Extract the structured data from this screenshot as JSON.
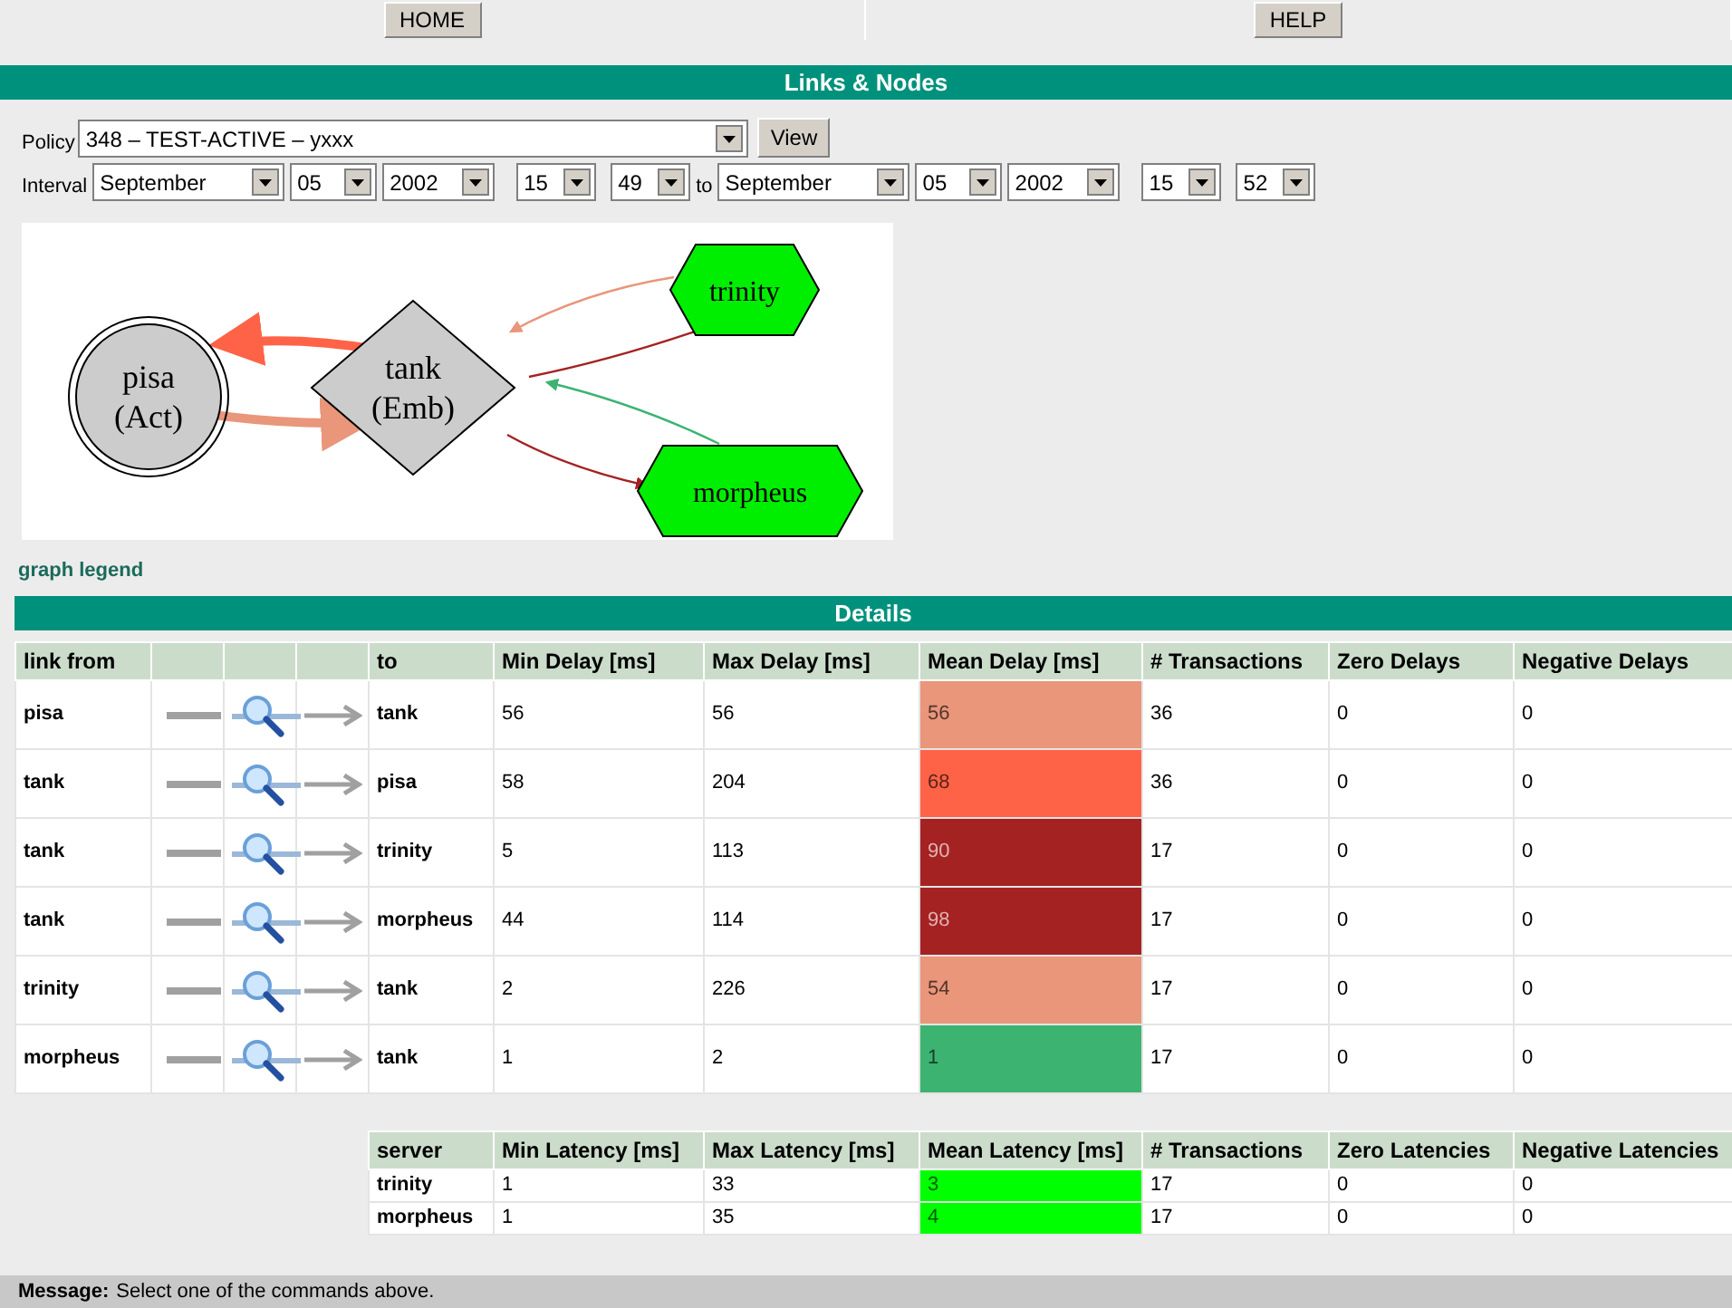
{
  "nav": [
    {
      "label": "HOME"
    },
    {
      "label": "HELP"
    }
  ],
  "links_header": "Links & Nodes",
  "policy": {
    "label": "Policy",
    "value": "348 – TEST-ACTIVE – yxxx",
    "button": "View"
  },
  "interval": {
    "label": "Interval",
    "from": [
      "September",
      "05",
      "2002",
      "15",
      "49"
    ],
    "to_label": "to",
    "to": [
      "September",
      "05",
      "2002",
      "15",
      "52"
    ]
  },
  "graph": {
    "nodes": [
      {
        "kind": "circle",
        "lines": [
          "pisa",
          "(Act)"
        ]
      },
      {
        "kind": "diamond",
        "lines": [
          "tank",
          "(Emb)"
        ]
      },
      {
        "kind": "hexagon",
        "lines": [
          "trinity"
        ]
      },
      {
        "kind": "hexagon",
        "lines": [
          "morpheus"
        ]
      }
    ]
  },
  "graph_legend": "graph legend",
  "details_header": "Details",
  "links_table": {
    "columns": [
      "link from",
      "to",
      "Min Delay [ms]",
      "Max Delay [ms]",
      "Mean Delay [ms]",
      "# Transactions",
      "Zero Delays",
      "Negative Delays"
    ],
    "rows": [
      {
        "from": "pisa",
        "to": "tank",
        "min": "56",
        "max": "56",
        "mean": "56",
        "color": "#e9967a",
        "transactions": "36",
        "zero": "0",
        "negative": "0"
      },
      {
        "from": "tank",
        "to": "pisa",
        "min": "58",
        "max": "204",
        "mean": "68",
        "color": "#ff6347",
        "transactions": "36",
        "zero": "0",
        "negative": "0"
      },
      {
        "from": "tank",
        "to": "trinity",
        "min": "5",
        "max": "113",
        "mean": "90",
        "color": "#a52222",
        "transactions": "17",
        "zero": "0",
        "negative": "0"
      },
      {
        "from": "tank",
        "to": "morpheus",
        "min": "44",
        "max": "114",
        "mean": "98",
        "color": "#a52222",
        "transactions": "17",
        "zero": "0",
        "negative": "0"
      },
      {
        "from": "trinity",
        "to": "tank",
        "min": "2",
        "max": "226",
        "mean": "54",
        "color": "#e9967a",
        "transactions": "17",
        "zero": "0",
        "negative": "0"
      },
      {
        "from": "morpheus",
        "to": "tank",
        "min": "1",
        "max": "2",
        "mean": "1",
        "color": "#3cb371",
        "transactions": "17",
        "zero": "0",
        "negative": "0"
      }
    ]
  },
  "servers_table": {
    "columns": [
      "server",
      "Min Latency [ms]",
      "Max Latency [ms]",
      "Mean Latency [ms]",
      "# Transactions",
      "Zero Latencies",
      "Negative Latencies"
    ],
    "rows": [
      {
        "server": "trinity",
        "min": "1",
        "max": "33",
        "mean": "3",
        "color": "#00ff00",
        "transactions": "17",
        "zero": "0",
        "negative": "0"
      },
      {
        "server": "morpheus",
        "min": "1",
        "max": "35",
        "mean": "4",
        "color": "#00ff00",
        "transactions": "17",
        "zero": "0",
        "negative": "0"
      }
    ]
  },
  "message": {
    "label": "Message:",
    "text": "Select one of the commands above."
  }
}
